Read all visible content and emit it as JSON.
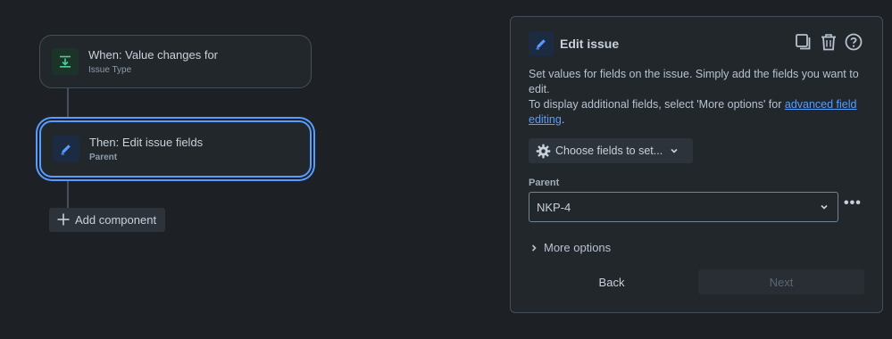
{
  "colors": {
    "background": "#1d2125",
    "accent": "#579dff",
    "trigger_icon": "#4bce97",
    "action_icon": "#579dff"
  },
  "flow": {
    "trigger": {
      "title": "When: Value changes for",
      "subtitle": "Issue Type",
      "icon": "download-arrow-icon"
    },
    "action": {
      "title": "Then: Edit issue fields",
      "subtitle": "Parent",
      "icon": "pencil-icon"
    },
    "add_component_label": "Add component"
  },
  "panel": {
    "title": "Edit issue",
    "icon": "pencil-icon",
    "header_actions": [
      "duplicate-icon",
      "trash-icon",
      "help-icon"
    ],
    "description_line1": "Set values for fields on the issue. Simply add the fields you want to edit.",
    "description_line2_prefix": "To display additional fields, select 'More options' for ",
    "description_link": "advanced field editing",
    "description_line2_suffix": ".",
    "choose_fields_label": "Choose fields to set...",
    "field_label": "Parent",
    "field_value": "NKP-4",
    "more_options_label": "More options",
    "back_label": "Back",
    "next_label": "Next"
  }
}
